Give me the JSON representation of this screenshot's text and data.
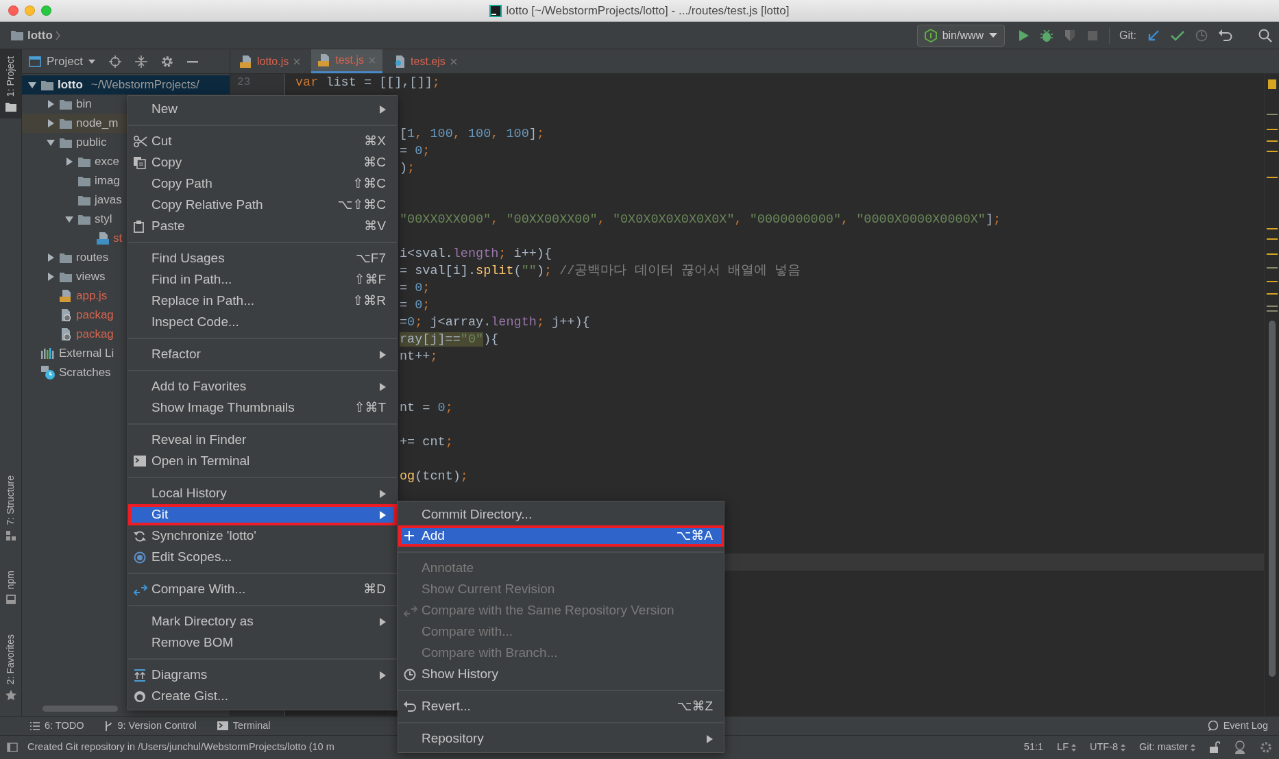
{
  "window": {
    "title": "lotto [~/WebstormProjects/lotto] - .../routes/test.js [lotto]"
  },
  "navbar": {
    "breadcrumb": "lotto",
    "run_config": "bin/www",
    "git_label": "Git:"
  },
  "tool_stripe": {
    "top": [
      {
        "label": "1: Project",
        "kind": "project",
        "selected": true
      }
    ],
    "bottom": [
      {
        "label": "7: Structure",
        "kind": "structure",
        "selected": false
      },
      {
        "label": "npm",
        "kind": "npm",
        "selected": false
      },
      {
        "label": "2: Favorites",
        "kind": "favorites",
        "selected": false
      }
    ]
  },
  "project_panel": {
    "title": "Project",
    "tree": [
      {
        "label": "lotto",
        "path": "~/WebstormProjects/",
        "kind": "folder",
        "expanded": true,
        "selected": true,
        "untracked": false,
        "children": [
          {
            "label": "bin",
            "kind": "folder",
            "expanded": false,
            "selected": false,
            "untracked": false
          },
          {
            "label": "node_m",
            "kind": "library-folder",
            "expanded": false,
            "selected": false,
            "untracked": false
          },
          {
            "label": "public",
            "kind": "folder",
            "expanded": true,
            "selected": false,
            "untracked": false,
            "children": [
              {
                "label": "exce",
                "kind": "folder",
                "expanded": false,
                "selected": false,
                "untracked": false
              },
              {
                "label": "imag",
                "kind": "folder",
                "selected": false,
                "untracked": false
              },
              {
                "label": "javas",
                "kind": "folder",
                "selected": false,
                "untracked": false
              },
              {
                "label": "styl",
                "kind": "folder",
                "expanded": true,
                "selected": false,
                "untracked": false,
                "children": [
                  {
                    "label": "st",
                    "kind": "css",
                    "selected": false,
                    "untracked": true
                  }
                ]
              }
            ]
          },
          {
            "label": "routes",
            "kind": "folder",
            "expanded": false,
            "selected": false,
            "untracked": false
          },
          {
            "label": "views",
            "kind": "folder",
            "expanded": false,
            "selected": false,
            "untracked": false
          },
          {
            "label": "app.js",
            "kind": "js",
            "selected": false,
            "untracked": true
          },
          {
            "label": "packag",
            "kind": "json",
            "selected": false,
            "untracked": true
          },
          {
            "label": "packag",
            "kind": "json",
            "selected": false,
            "untracked": true
          }
        ]
      },
      {
        "label": "External Li",
        "kind": "libraries",
        "selected": false,
        "untracked": false
      },
      {
        "label": "Scratches",
        "kind": "scratches",
        "selected": false,
        "untracked": false
      }
    ]
  },
  "editor_tabs": [
    {
      "label": "lotto.js",
      "kind": "js",
      "selected": false
    },
    {
      "label": "test.js",
      "kind": "js",
      "selected": true
    },
    {
      "label": "test.ejs",
      "kind": "ejs",
      "selected": false
    }
  ],
  "editor": {
    "lines": [
      {
        "number": "23",
        "kind": "full",
        "current": false,
        "segments": [
          {
            "text": "var",
            "kind": "keyword"
          },
          {
            "text": " list = [[],[]]",
            "kind": "plain"
          },
          {
            "text": ";",
            "kind": "punct"
          }
        ]
      },
      {
        "current": false
      },
      {
        "current": false
      },
      {
        "kind": "clipped",
        "current": false,
        "segments": [
          {
            "text": "[",
            "kind": "plain"
          },
          {
            "text": "1",
            "kind": "number"
          },
          {
            "text": ", ",
            "kind": "punct"
          },
          {
            "text": "100",
            "kind": "number"
          },
          {
            "text": ", ",
            "kind": "punct"
          },
          {
            "text": "100",
            "kind": "number"
          },
          {
            "text": ", ",
            "kind": "punct"
          },
          {
            "text": "100",
            "kind": "number"
          },
          {
            "text": "]",
            "kind": "plain"
          },
          {
            "text": ";",
            "kind": "punct"
          }
        ]
      },
      {
        "kind": "clipped",
        "current": false,
        "segments": [
          {
            "text": "= ",
            "kind": "plain"
          },
          {
            "text": "0",
            "kind": "number"
          },
          {
            "text": ";",
            "kind": "punct"
          }
        ]
      },
      {
        "kind": "clipped",
        "current": false,
        "segments": [
          {
            "text": ")",
            "kind": "plain"
          },
          {
            "text": ";",
            "kind": "punct"
          }
        ]
      },
      {
        "current": false
      },
      {
        "current": false
      },
      {
        "kind": "clipped",
        "current": false,
        "segments": [
          {
            "text": "\"00XX0XX000\"",
            "kind": "string"
          },
          {
            "text": ", ",
            "kind": "punct"
          },
          {
            "text": "\"00XX00XX00\"",
            "kind": "string"
          },
          {
            "text": ", ",
            "kind": "punct"
          },
          {
            "text": "\"0X0X0X0X0X0X0X\"",
            "kind": "string"
          },
          {
            "text": ", ",
            "kind": "punct"
          },
          {
            "text": "\"0000000000\"",
            "kind": "string"
          },
          {
            "text": ", ",
            "kind": "punct"
          },
          {
            "text": "\"0000X0000X0000X\"",
            "kind": "string"
          },
          {
            "text": "]",
            "kind": "plain"
          },
          {
            "text": ";",
            "kind": "punct"
          }
        ]
      },
      {
        "current": false
      },
      {
        "kind": "clipped",
        "current": false,
        "segments": [
          {
            "text": "i<sval.",
            "kind": "plain"
          },
          {
            "text": "length",
            "kind": "prop"
          },
          {
            "text": ";",
            "kind": "punct"
          },
          {
            "text": " i++){",
            "kind": "plain"
          }
        ]
      },
      {
        "kind": "clipped",
        "current": false,
        "segments": [
          {
            "text": "= sval[i].",
            "kind": "plain"
          },
          {
            "text": "split",
            "kind": "fn"
          },
          {
            "text": "(",
            "kind": "plain"
          },
          {
            "text": "\"\"",
            "kind": "string"
          },
          {
            "text": ")",
            "kind": "plain"
          },
          {
            "text": ";",
            "kind": "punct"
          },
          {
            "text": " //공백마다 데이터 끊어서 배열에 넣음",
            "kind": "comment"
          }
        ]
      },
      {
        "kind": "clipped",
        "current": false,
        "segments": [
          {
            "text": "= ",
            "kind": "plain"
          },
          {
            "text": "0",
            "kind": "number"
          },
          {
            "text": ";",
            "kind": "punct"
          }
        ]
      },
      {
        "kind": "clipped",
        "current": false,
        "segments": [
          {
            "text": "= ",
            "kind": "plain"
          },
          {
            "text": "0",
            "kind": "number"
          },
          {
            "text": ";",
            "kind": "punct"
          }
        ]
      },
      {
        "kind": "clipped",
        "current": false,
        "segments": [
          {
            "text": "=",
            "kind": "plain"
          },
          {
            "text": "0",
            "kind": "number"
          },
          {
            "text": ";",
            "kind": "punct"
          },
          {
            "text": " j<array.",
            "kind": "plain"
          },
          {
            "text": "length",
            "kind": "prop"
          },
          {
            "text": ";",
            "kind": "punct"
          },
          {
            "text": " j++){",
            "kind": "plain"
          }
        ]
      },
      {
        "kind": "clipped",
        "current": false,
        "segments": [
          {
            "text": "ray[j]==",
            "kind": "plain",
            "highlighted": true
          },
          {
            "text": "\"0\"",
            "kind": "string",
            "highlighted": true
          },
          {
            "text": "){",
            "kind": "plain"
          }
        ]
      },
      {
        "kind": "clipped",
        "current": false,
        "segments": [
          {
            "text": "nt++",
            "kind": "plain"
          },
          {
            "text": ";",
            "kind": "punct"
          }
        ]
      },
      {
        "current": false
      },
      {
        "current": false
      },
      {
        "kind": "clipped",
        "current": false,
        "segments": [
          {
            "text": "nt = ",
            "kind": "plain"
          },
          {
            "text": "0",
            "kind": "number"
          },
          {
            "text": ";",
            "kind": "punct"
          }
        ]
      },
      {
        "current": false
      },
      {
        "kind": "clipped",
        "current": false,
        "segments": [
          {
            "text": "+= cnt",
            "kind": "plain"
          },
          {
            "text": ";",
            "kind": "punct"
          }
        ]
      },
      {
        "current": false
      },
      {
        "kind": "clipped",
        "current": false,
        "segments": [
          {
            "text": "og",
            "kind": "fn"
          },
          {
            "text": "(tcnt)",
            "kind": "plain"
          },
          {
            "text": ";",
            "kind": "punct"
          }
        ]
      },
      {
        "current": false
      },
      {
        "current": false
      },
      {
        "current": false
      },
      {
        "current": false
      },
      {
        "current": true
      }
    ]
  },
  "context_menu": {
    "items": [
      {
        "label": "New",
        "kind": "item",
        "submenu": true,
        "selected": false,
        "annotated": false
      },
      {
        "kind": "separator"
      },
      {
        "label": "Cut",
        "kind": "cut",
        "shortcut": "⌘X",
        "submenu": false,
        "selected": false,
        "annotated": false
      },
      {
        "label": "Copy",
        "kind": "copy",
        "shortcut": "⌘C",
        "submenu": false,
        "selected": false,
        "annotated": false
      },
      {
        "label": "Copy Path",
        "kind": "item",
        "shortcut": "⇧⌘C",
        "submenu": false,
        "selected": false,
        "annotated": false
      },
      {
        "label": "Copy Relative Path",
        "kind": "item",
        "shortcut": "⌥⇧⌘C",
        "submenu": false,
        "selected": false,
        "annotated": false
      },
      {
        "label": "Paste",
        "kind": "paste",
        "shortcut": "⌘V",
        "submenu": false,
        "selected": false,
        "annotated": false
      },
      {
        "kind": "separator"
      },
      {
        "label": "Find Usages",
        "kind": "item",
        "shortcut": "⌥F7",
        "submenu": false,
        "selected": false,
        "annotated": false
      },
      {
        "label": "Find in Path...",
        "kind": "item",
        "shortcut": "⇧⌘F",
        "submenu": false,
        "selected": false,
        "annotated": false
      },
      {
        "label": "Replace in Path...",
        "kind": "item",
        "shortcut": "⇧⌘R",
        "submenu": false,
        "selected": false,
        "annotated": false
      },
      {
        "label": "Inspect Code...",
        "kind": "item",
        "submenu": false,
        "selected": false,
        "annotated": false
      },
      {
        "kind": "separator"
      },
      {
        "label": "Refactor",
        "kind": "item",
        "submenu": true,
        "selected": false,
        "annotated": false
      },
      {
        "kind": "separator"
      },
      {
        "label": "Add to Favorites",
        "kind": "item",
        "submenu": true,
        "selected": false,
        "annotated": false
      },
      {
        "label": "Show Image Thumbnails",
        "kind": "item",
        "shortcut": "⇧⌘T",
        "submenu": false,
        "selected": false,
        "annotated": false
      },
      {
        "kind": "separator"
      },
      {
        "label": "Reveal in Finder",
        "kind": "item",
        "submenu": false,
        "selected": false,
        "annotated": false
      },
      {
        "label": "Open in Terminal",
        "kind": "terminal",
        "submenu": false,
        "selected": false,
        "annotated": false
      },
      {
        "kind": "separator"
      },
      {
        "label": "Local History",
        "kind": "item",
        "submenu": true,
        "selected": false,
        "annotated": false
      },
      {
        "label": "Git",
        "kind": "item",
        "submenu": true,
        "selected": true,
        "annotated": true
      },
      {
        "label": "Synchronize 'lotto'",
        "kind": "sync",
        "submenu": false,
        "selected": false,
        "annotated": false
      },
      {
        "label": "Edit Scopes...",
        "kind": "scopes",
        "submenu": false,
        "selected": false,
        "annotated": false
      },
      {
        "kind": "separator"
      },
      {
        "label": "Compare With...",
        "kind": "compare",
        "shortcut": "⌘D",
        "submenu": false,
        "selected": false,
        "annotated": false
      },
      {
        "kind": "separator"
      },
      {
        "label": "Mark Directory as",
        "kind": "item",
        "submenu": true,
        "selected": false,
        "annotated": false
      },
      {
        "label": "Remove BOM",
        "kind": "item",
        "submenu": false,
        "selected": false,
        "annotated": false
      },
      {
        "kind": "separator"
      },
      {
        "label": "Diagrams",
        "kind": "diagrams",
        "submenu": true,
        "selected": false,
        "annotated": false
      },
      {
        "label": "Create Gist...",
        "kind": "gist",
        "submenu": false,
        "selected": false,
        "annotated": false
      }
    ]
  },
  "git_submenu": {
    "items": [
      {
        "label": "Commit Directory...",
        "kind": "item",
        "submenu": false,
        "selected": false,
        "annotated": false,
        "disabled": false
      },
      {
        "label": "Add",
        "kind": "add",
        "shortcut": "⌥⌘A",
        "submenu": false,
        "selected": true,
        "annotated": true,
        "disabled": false
      },
      {
        "kind": "separator"
      },
      {
        "label": "Annotate",
        "kind": "item",
        "submenu": false,
        "selected": false,
        "annotated": false,
        "disabled": true
      },
      {
        "label": "Show Current Revision",
        "kind": "item",
        "submenu": false,
        "selected": false,
        "annotated": false,
        "disabled": true
      },
      {
        "label": "Compare with the Same Repository Version",
        "kind": "compare",
        "submenu": false,
        "selected": false,
        "annotated": false,
        "disabled": true
      },
      {
        "label": "Compare with...",
        "kind": "item",
        "submenu": false,
        "selected": false,
        "annotated": false,
        "disabled": true
      },
      {
        "label": "Compare with Branch...",
        "kind": "item",
        "submenu": false,
        "selected": false,
        "annotated": false,
        "disabled": true
      },
      {
        "label": "Show History",
        "kind": "history",
        "submenu": false,
        "selected": false,
        "annotated": false,
        "disabled": false
      },
      {
        "kind": "separator"
      },
      {
        "label": "Revert...",
        "kind": "revert",
        "shortcut": "⌥⌘Z",
        "submenu": false,
        "selected": false,
        "annotated": false,
        "disabled": false
      },
      {
        "kind": "separator"
      },
      {
        "label": "Repository",
        "kind": "item",
        "submenu": true,
        "selected": false,
        "annotated": false,
        "disabled": false
      }
    ]
  },
  "bottom_toolbar": {
    "left": [
      {
        "label": "6: TODO",
        "kind": "todo"
      },
      {
        "label": "9: Version Control",
        "kind": "vcs"
      },
      {
        "label": "Terminal",
        "kind": "terminal"
      }
    ],
    "right": [
      {
        "label": "Event Log",
        "kind": "event-log"
      }
    ]
  },
  "status_bar": {
    "message": "Created Git repository in /Users/junchul/WebstormProjects/lotto (10 m",
    "widgets": [
      {
        "label": "51:1",
        "kind": "position"
      },
      {
        "label": "LF",
        "kind": "selector"
      },
      {
        "label": "UTF-8",
        "kind": "selector"
      },
      {
        "label": "Git: master",
        "kind": "selector"
      }
    ]
  }
}
